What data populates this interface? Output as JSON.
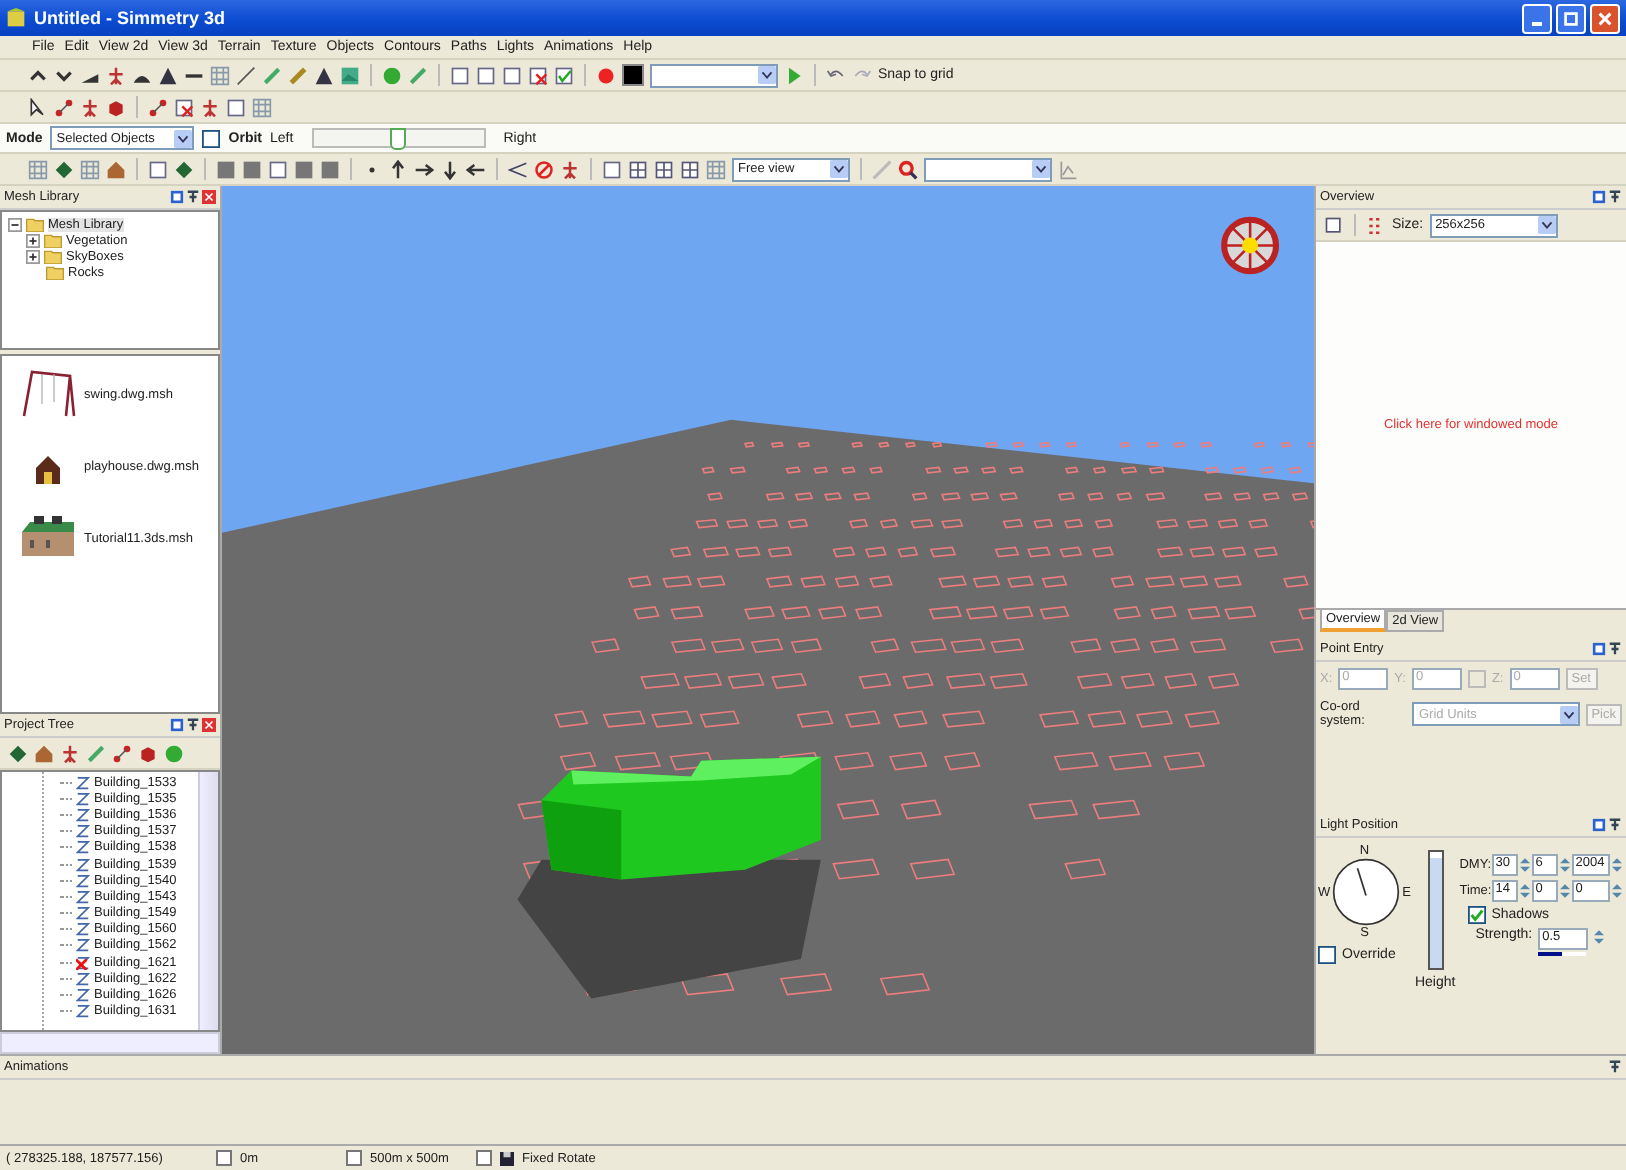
{
  "window": {
    "title": "Untitled - Simmetry 3d"
  },
  "menu": [
    "File",
    "Edit",
    "View 2d",
    "View 3d",
    "Terrain",
    "Texture",
    "Objects",
    "Contours",
    "Paths",
    "Lights",
    "Animations",
    "Help"
  ],
  "toolbar": {
    "snap_label": "Snap to grid",
    "mode_label": "Mode",
    "mode_value": "Selected Objects",
    "orbit": {
      "label": "Orbit",
      "checked": false
    },
    "left_label": "Left",
    "right_label": "Right",
    "orbit_slider": {
      "level": 0.5
    },
    "view_value": "Free view"
  },
  "mesh_library": {
    "title": "Mesh Library",
    "tree": [
      {
        "label": "Mesh Library",
        "expanded": true,
        "selected": true,
        "children": [
          {
            "label": "Vegetation",
            "expanded": false,
            "selected": false
          },
          {
            "label": "SkyBoxes",
            "expanded": false,
            "selected": false
          },
          {
            "label": "Rocks",
            "selected": false
          }
        ]
      }
    ],
    "meshes": [
      {
        "kind": "swing",
        "label": "swing.dwg.msh"
      },
      {
        "kind": "house",
        "label": "playhouse.dwg.msh"
      },
      {
        "kind": "building",
        "label": "Tutorial11.3ds.msh"
      }
    ]
  },
  "project_tree": {
    "title": "Project Tree",
    "items": [
      {
        "label": "Building_1533",
        "flagged": false
      },
      {
        "label": "Building_1535",
        "flagged": false
      },
      {
        "label": "Building_1536",
        "flagged": false
      },
      {
        "label": "Building_1537",
        "flagged": false
      },
      {
        "label": "Building_1538",
        "flagged": false
      },
      {
        "label": "Building_1539",
        "flagged": false
      },
      {
        "label": "Building_1540",
        "flagged": false
      },
      {
        "label": "Building_1543",
        "flagged": false
      },
      {
        "label": "Building_1549",
        "flagged": false
      },
      {
        "label": "Building_1560",
        "flagged": false
      },
      {
        "label": "Building_1562",
        "flagged": false
      },
      {
        "label": "Building_1621",
        "flagged": true
      },
      {
        "label": "Building_1622",
        "flagged": false
      },
      {
        "label": "Building_1626",
        "flagged": false
      },
      {
        "label": "Building_1631",
        "flagged": false
      }
    ]
  },
  "overview": {
    "title": "Overview",
    "size_label": "Size:",
    "size_value": "256x256",
    "message": "Click here for windowed mode",
    "tabs": [
      {
        "label": "Overview",
        "selected": true
      },
      {
        "label": "2d View",
        "selected": false
      }
    ]
  },
  "point_entry": {
    "title": "Point Entry",
    "disabled": true,
    "x_label": "X:",
    "x_value": "0",
    "y_label": "Y:",
    "y_value": "0",
    "z_label": "Z:",
    "z_value": "0",
    "set_button": "Set",
    "coord_label": "Co-ord system:",
    "coord_value": "Grid Units",
    "pick_button": "Pick"
  },
  "light_position": {
    "title": "Light Position",
    "compass": {
      "n": "N",
      "e": "E",
      "s": "S",
      "w": "W"
    },
    "override": {
      "label": "Override",
      "checked": false
    },
    "height": {
      "label": "Height",
      "level": 0.95
    },
    "dmy_label": "DMY:",
    "dmy": [
      "30",
      "6",
      "2004"
    ],
    "time_label": "Time:",
    "time": [
      "14",
      "0",
      "0"
    ],
    "shadows": {
      "label": "Shadows",
      "checked": true
    },
    "strength_label": "Strength:",
    "strength_value": "0.5",
    "strength": {
      "level": 0.5
    }
  },
  "animations": {
    "title": "Animations"
  },
  "status_bar": {
    "coordinates": "( 278325.188,  187577.156)",
    "elevation": "0m",
    "area": "500m x 500m",
    "rotate": "Fixed Rotate"
  }
}
